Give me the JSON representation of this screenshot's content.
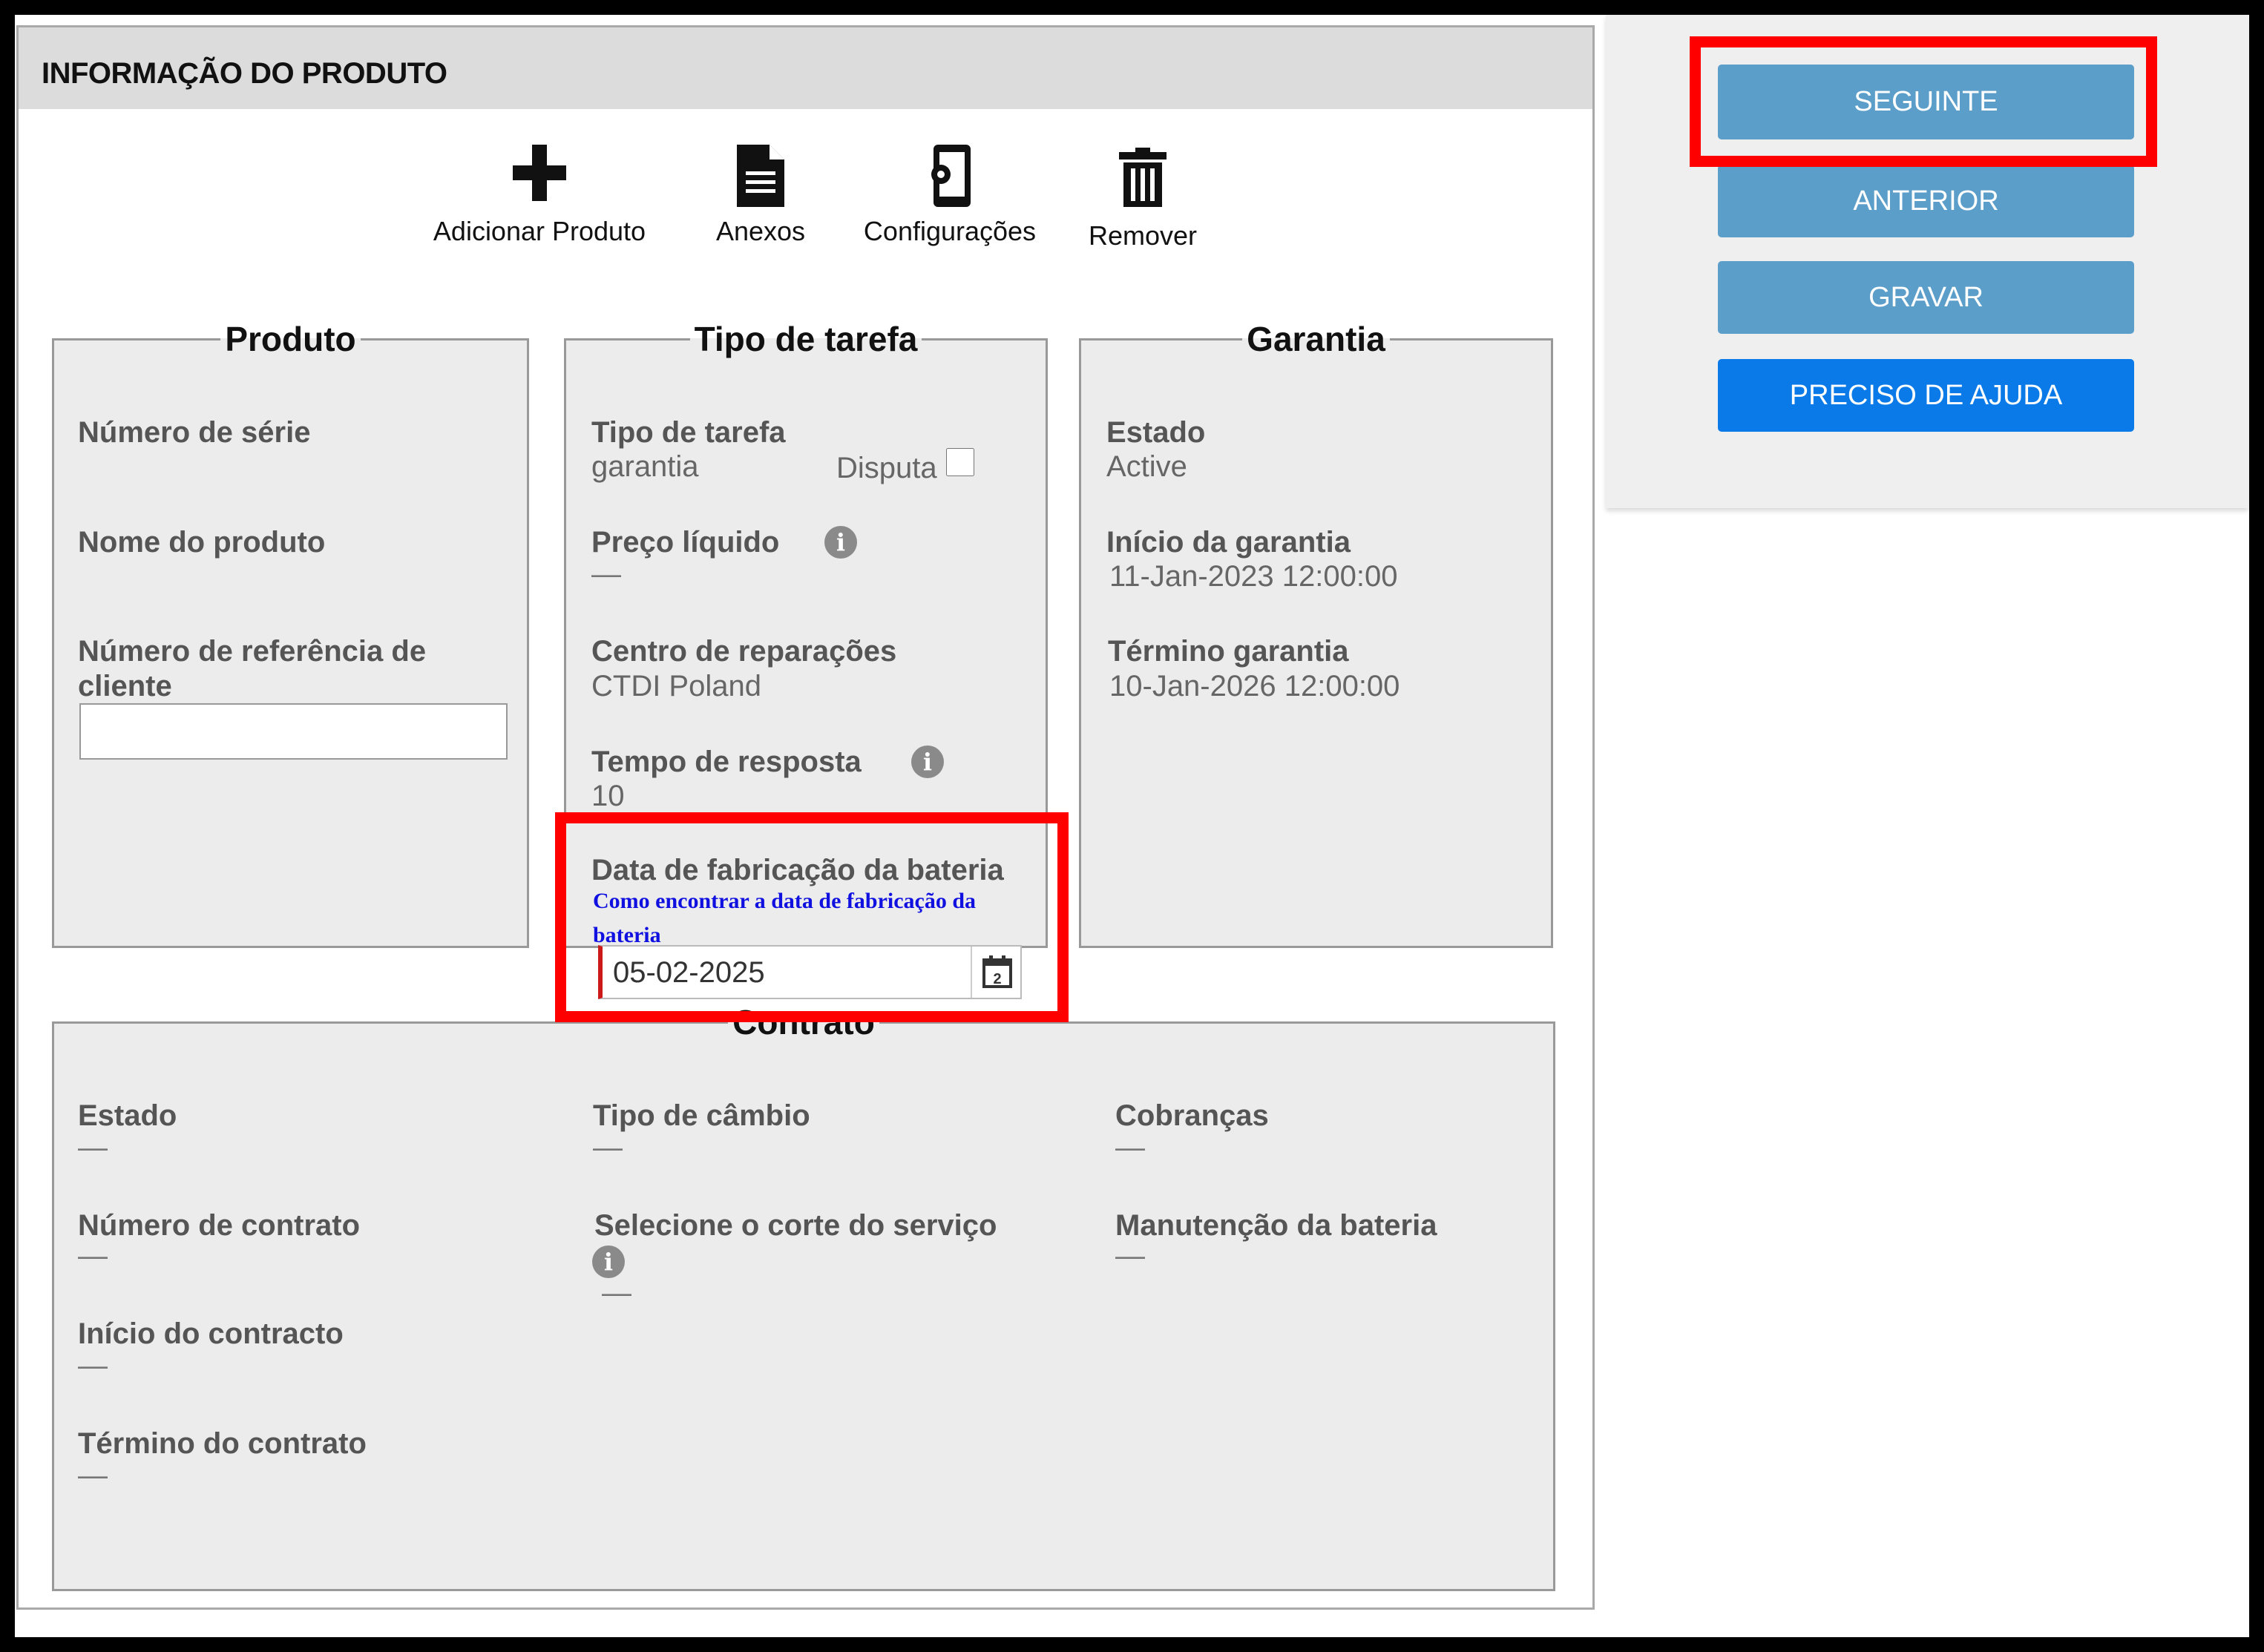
{
  "header": {
    "title": "INFORMAÇÃO DO PRODUTO"
  },
  "toolbar": [
    {
      "label": "Adicionar Produto",
      "icon": "plus-icon"
    },
    {
      "label": "Anexos",
      "icon": "document-icon"
    },
    {
      "label": "Configurações",
      "icon": "device-settings-icon"
    },
    {
      "label": "Remover",
      "icon": "trash-icon"
    }
  ],
  "produto": {
    "legend": "Produto",
    "serial_label": "Número de série",
    "name_label": "Nome do produto",
    "ref_label_line1": "Número de referência de",
    "ref_label_line2": "cliente",
    "ref_value": ""
  },
  "tarefa": {
    "legend": "Tipo de tarefa",
    "type_label": "Tipo de tarefa",
    "type_value": "garantia",
    "dispute_label": "Disputa",
    "dispute_checked": false,
    "price_label": "Preço líquido",
    "price_value": "—",
    "repair_label": "Centro de reparações",
    "repair_value": "CTDI Poland",
    "response_label": "Tempo de resposta",
    "response_value": "10",
    "battery_label": "Data de fabricação da bateria",
    "battery_link_line1": "Como encontrar a data de fabricação da",
    "battery_link_line2": "bateria",
    "battery_date": "05-02-2025",
    "calendar_digit": "2"
  },
  "garantia": {
    "legend": "Garantia",
    "status_label": "Estado",
    "status_value": "Active",
    "start_label": "Início da garantia",
    "start_value": "11-Jan-2023 12:00:00",
    "end_label": "Término garantia",
    "end_value": "10-Jan-2026 12:00:00"
  },
  "contrato": {
    "legend": "Contrato",
    "status_label": "Estado",
    "status_value": "—",
    "number_label": "Número de contrato",
    "number_value": "—",
    "start_label": "Início do contracto",
    "start_value": "—",
    "end_label": "Término do contrato",
    "end_value": "—",
    "exchange_label": "Tipo de câmbio",
    "exchange_value": "—",
    "cut_label": "Selecione o corte do serviço",
    "cut_value": "—",
    "charges_label": "Cobranças",
    "charges_value": "—",
    "battery_label": "Manutenção da bateria",
    "battery_value": "—"
  },
  "sidebar": {
    "next": "SEGUINTE",
    "previous": "ANTERIOR",
    "save": "GRAVAR",
    "help": "PRECISO DE AJUDA"
  },
  "colors": {
    "highlight": "#ff0000",
    "button": "#5b9ec9",
    "primary_button": "#0a7ae8",
    "link": "#1010e0"
  }
}
